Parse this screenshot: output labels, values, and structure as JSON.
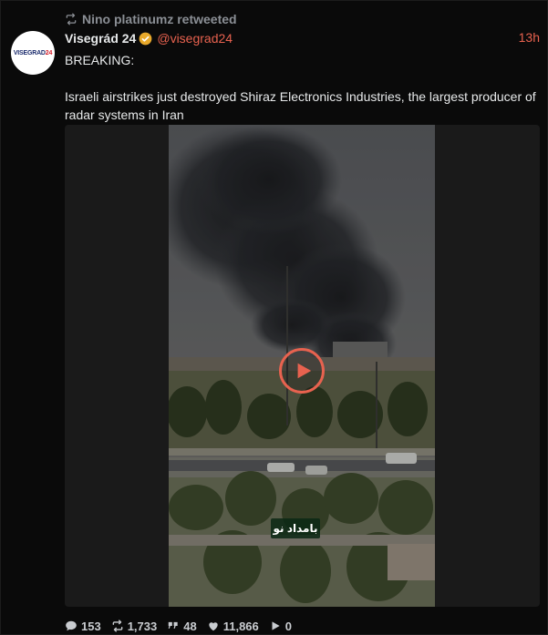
{
  "retweet": {
    "label": "Nino platinumz retweeted",
    "icon": "retweet-icon"
  },
  "author": {
    "name": "Visegrád 24",
    "handle": "@visegrad24",
    "verified_icon": "verified-badge-icon",
    "avatar_text_main": "VISEGRAD",
    "avatar_text_accent": "24"
  },
  "timestamp": "13h",
  "tweet": {
    "text": "BREAKING:\n\nIsraeli airstrikes just destroyed Shiraz Electronics Industries, the largest producer of radar systems in Iran"
  },
  "media": {
    "type": "video",
    "play_icon": "play-icon",
    "watermark": "بامداد نو"
  },
  "stats": {
    "replies": "153",
    "retweets": "1,733",
    "quotes": "48",
    "likes": "11,866",
    "views": "0"
  },
  "colors": {
    "accent": "#e8624f",
    "verified": "#e8a92b",
    "background": "#0a0a0a",
    "text": "#e7e9ea",
    "muted": "#8b8f95"
  }
}
